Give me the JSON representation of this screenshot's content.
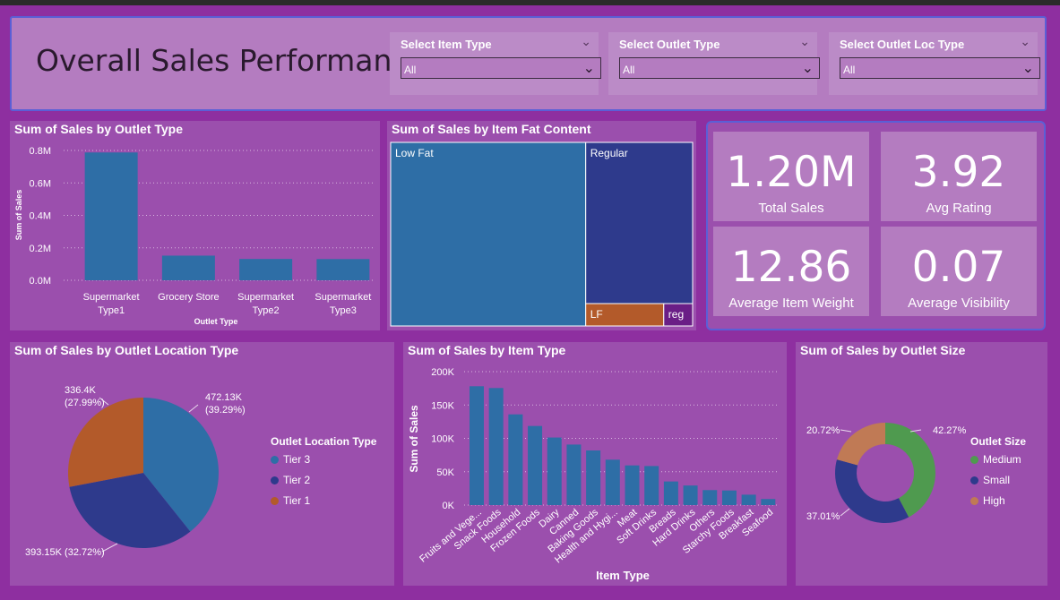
{
  "header": {
    "title": "Overall Sales Performance",
    "slicers": [
      {
        "label": "Select Item Type",
        "value": "All"
      },
      {
        "label": "Select Outlet Type",
        "value": "All"
      },
      {
        "label": "Select Outlet Loc Type",
        "value": "All"
      }
    ]
  },
  "colors": {
    "background": "#8e2fa0",
    "panel": "#9b4fad",
    "header": "#b47cc0",
    "bar": "#2e6ea6",
    "navy": "#2e3a8c",
    "orange": "#b35a2a",
    "green": "#4f9a4f"
  },
  "kpis": [
    {
      "value": "1.20M",
      "label": "Total Sales"
    },
    {
      "value": "3.92",
      "label": "Avg Rating"
    },
    {
      "value": "12.86",
      "label": "Average Item Weight"
    },
    {
      "value": "0.07",
      "label": "Average Visibility"
    }
  ],
  "chart_data": [
    {
      "type": "bar",
      "title": "Sum of Sales by Outlet Type",
      "xlabel": "Outlet Type",
      "ylabel": "Sum of Sales",
      "categories": [
        "Supermarket Type1",
        "Grocery Store",
        "Supermarket Type2",
        "Supermarket Type3"
      ],
      "values": [
        787549,
        151939,
        131477,
        130714
      ],
      "ylim": [
        0,
        800000
      ],
      "yticks": [
        "0.0M",
        "0.2M",
        "0.4M",
        "0.6M",
        "0.8M"
      ],
      "grid": true
    },
    {
      "type": "treemap",
      "title": "Sum of Sales by Item Fat Content",
      "categories": [
        "Low Fat",
        "Regular",
        "LF",
        "reg"
      ],
      "values": [
        776319,
        425361,
        117.02,
        0
      ]
    },
    {
      "type": "pie",
      "title": "Sum of Sales by Outlet Location Type",
      "legend_title": "Outlet Location Type",
      "categories": [
        "Tier 3",
        "Tier 2",
        "Tier 1"
      ],
      "values": [
        472130,
        393150,
        336400
      ],
      "percent": [
        39.29,
        32.72,
        27.99
      ],
      "labels": [
        "472.13K\n(39.29%)",
        "393.15K (32.72%)",
        "336.4K\n(27.99%)"
      ],
      "legend_position": "right"
    },
    {
      "type": "bar",
      "title": "Sum of Sales by Item Type",
      "xlabel": "Item Type",
      "ylabel": "Sum of Sales",
      "categories": [
        "Fruits and Vege...",
        "Snack Foods",
        "Household",
        "Frozen Foods",
        "Dairy",
        "Canned",
        "Baking Goods",
        "Health and Hygi...",
        "Meat",
        "Soft Drinks",
        "Breads",
        "Hard Drinks",
        "Others",
        "Starchy Foods",
        "Breakfast",
        "Seafood"
      ],
      "values": [
        178124,
        175434,
        135977,
        118559,
        101276,
        90706,
        81895,
        68025,
        59449,
        58514,
        35380,
        29334,
        22451,
        21880,
        15597,
        9078
      ],
      "ylim": [
        0,
        200000
      ],
      "yticks": [
        "0K",
        "50K",
        "100K",
        "150K",
        "200K"
      ],
      "grid": true
    },
    {
      "type": "pie",
      "title": "Sum of Sales by Outlet Size",
      "variant": "donut",
      "legend_title": "Outlet Size",
      "categories": [
        "Medium",
        "Small",
        "High"
      ],
      "values": [
        42.27,
        37.01,
        20.72
      ],
      "labels": [
        "42.27%",
        "37.01%",
        "20.72%"
      ],
      "legend_position": "right"
    }
  ]
}
